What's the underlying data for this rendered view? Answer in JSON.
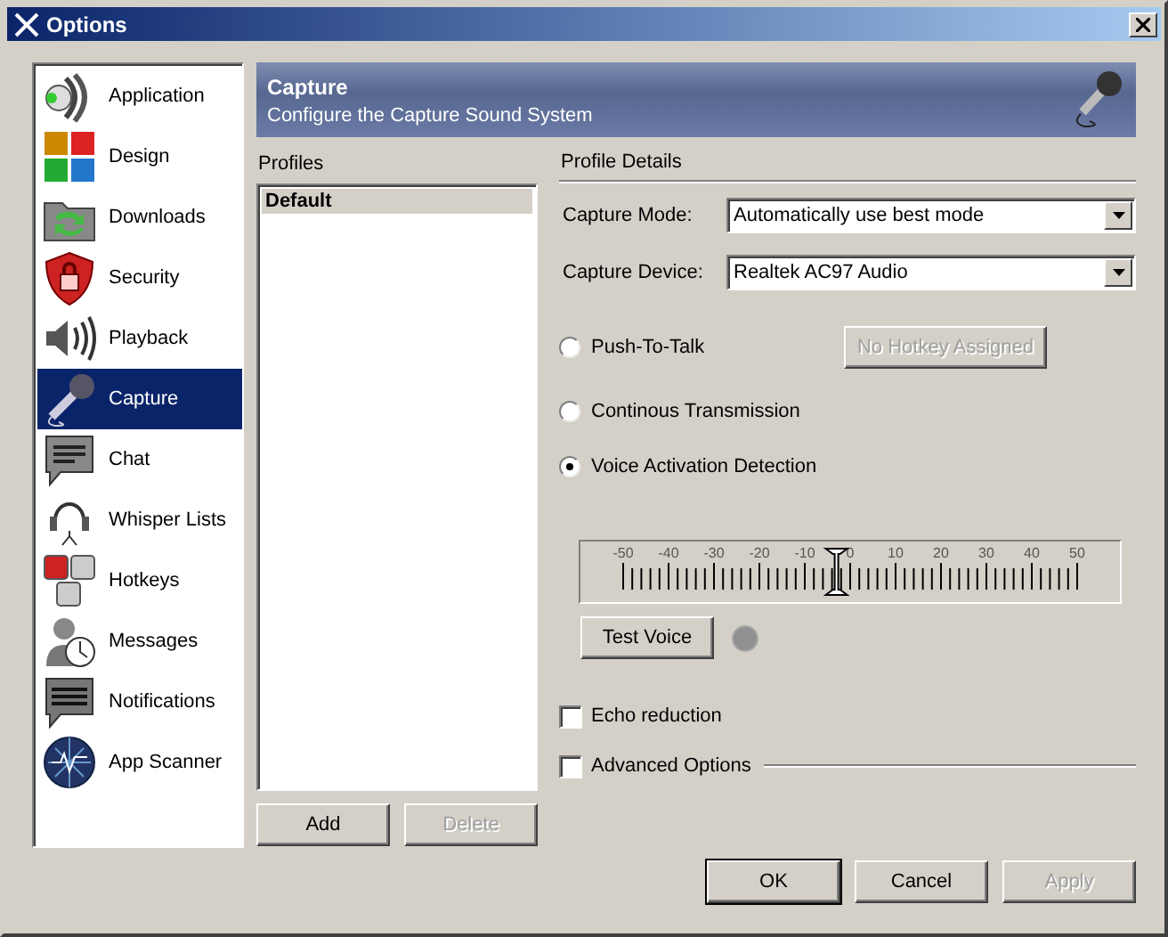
{
  "window": {
    "title": "Options"
  },
  "sidebar": {
    "items": [
      {
        "label": "Application",
        "selected": false
      },
      {
        "label": "Design",
        "selected": false
      },
      {
        "label": "Downloads",
        "selected": false
      },
      {
        "label": "Security",
        "selected": false
      },
      {
        "label": "Playback",
        "selected": false
      },
      {
        "label": "Capture",
        "selected": true
      },
      {
        "label": "Chat",
        "selected": false
      },
      {
        "label": "Whisper Lists",
        "selected": false
      },
      {
        "label": "Hotkeys",
        "selected": false
      },
      {
        "label": "Messages",
        "selected": false
      },
      {
        "label": "Notifications",
        "selected": false
      },
      {
        "label": "App Scanner",
        "selected": false
      }
    ]
  },
  "header": {
    "title": "Capture",
    "subtitle": "Configure the Capture Sound System"
  },
  "profiles": {
    "label": "Profiles",
    "items": [
      {
        "label": "Default",
        "selected": true
      }
    ],
    "buttons": [
      {
        "label": "Add",
        "disabled": false
      },
      {
        "label": "Delete",
        "disabled": true
      }
    ]
  },
  "details": {
    "label": "Profile Details",
    "fields": [
      {
        "label": "Capture Mode:",
        "value": "Automatically use best mode"
      },
      {
        "label": "Capture Device:",
        "value": "Realtek AC97 Audio"
      }
    ],
    "transmission": [
      {
        "label": "Push-To-Talk",
        "selected": false
      },
      {
        "label": "Continous Transmission",
        "selected": false
      },
      {
        "label": "Voice Activation Detection",
        "selected": true
      }
    ],
    "hotkey_button": {
      "label": "No Hotkey Assigned",
      "disabled": true
    },
    "vad": {
      "scale_labels": [
        "-50",
        "-40",
        "-30",
        "-20",
        "-10",
        "0",
        "10",
        "20",
        "30",
        "40",
        "50"
      ],
      "level": 0.47
    },
    "test_button": {
      "label": "Test Voice",
      "disabled": false
    },
    "voice_indicator": {
      "on": false
    },
    "options": [
      {
        "kind": "checkbox",
        "label": "Echo reduction",
        "checked": false
      },
      {
        "kind": "group-checkbox",
        "label": "Advanced Options",
        "checked": false
      }
    ]
  },
  "buttons": [
    {
      "label": "OK",
      "disabled": false,
      "focused": true
    },
    {
      "label": "Cancel",
      "disabled": false,
      "focused": false
    },
    {
      "label": "Apply",
      "disabled": true,
      "focused": false
    }
  ]
}
